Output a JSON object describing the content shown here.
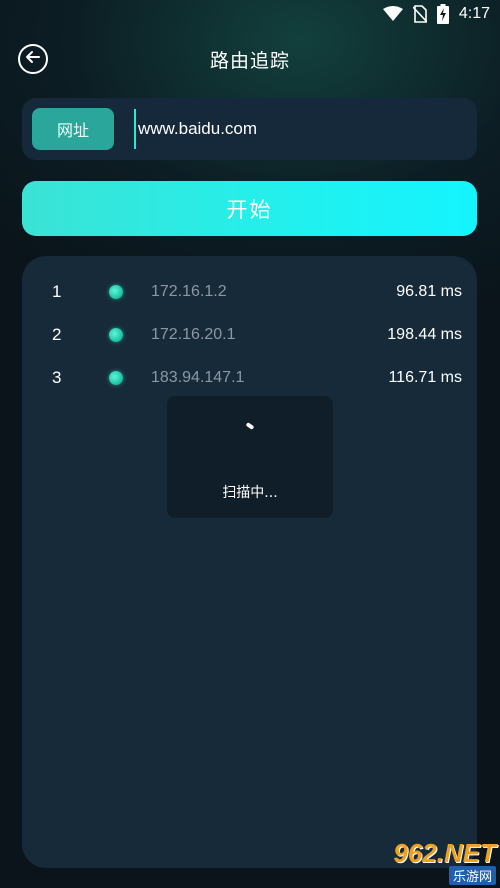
{
  "status_bar": {
    "time": "4:17",
    "icons": [
      "wifi-icon",
      "no-sim-icon",
      "battery-charging-icon"
    ]
  },
  "header": {
    "title": "路由追踪",
    "back_icon": "back-arrow-circle-icon"
  },
  "url_input": {
    "label": "网址",
    "value": "www.baidu.com"
  },
  "start_button": {
    "label": "开始"
  },
  "hops": [
    {
      "index": "1",
      "ip": "172.16.1.2",
      "time": "96.81 ms"
    },
    {
      "index": "2",
      "ip": "172.16.20.1",
      "time": "198.44 ms"
    },
    {
      "index": "3",
      "ip": "183.94.147.1",
      "time": "116.71 ms"
    }
  ],
  "scanning": {
    "text": "扫描中..."
  },
  "watermark": {
    "logo": "962.NET",
    "sub": "乐游网"
  },
  "colors": {
    "accent": "#2aa69a",
    "button_gradient_start": "#3be3d4",
    "button_gradient_end": "#14f4ff",
    "panel": "#172a3a",
    "status_dot": "#1fc7a7"
  }
}
